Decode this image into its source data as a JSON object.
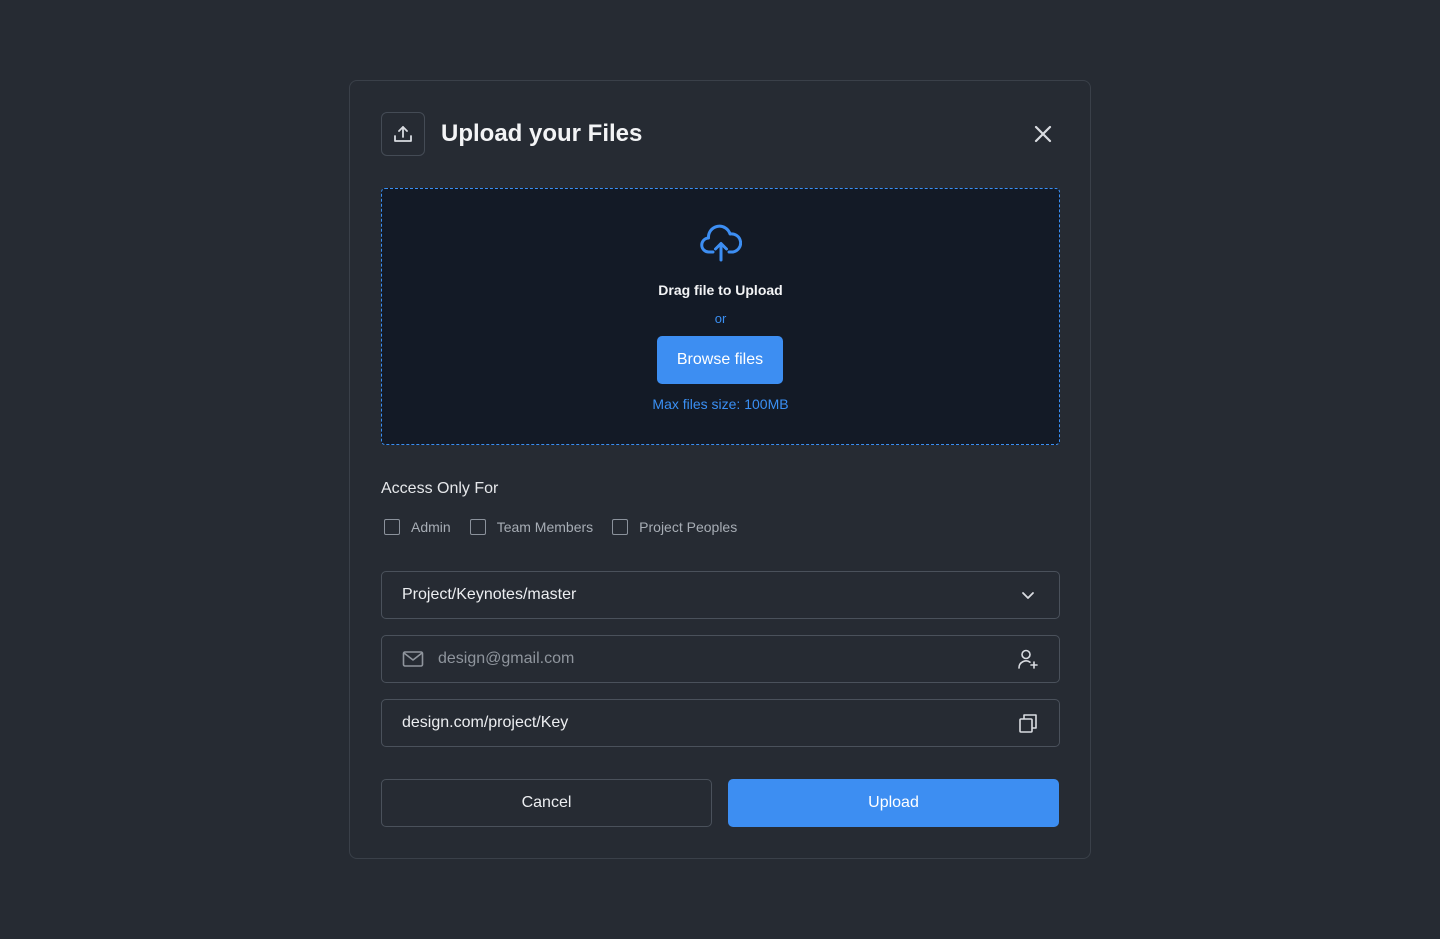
{
  "dialog": {
    "title": "Upload your Files",
    "header_icon": "upload-icon",
    "close_icon": "close-icon"
  },
  "dropzone": {
    "icon": "cloud-upload-icon",
    "drag_text": "Drag file to Upload",
    "or_text": "or",
    "browse_label": "Browse files",
    "max_size_text": "Max files size: 100MB"
  },
  "access": {
    "label": "Access Only For",
    "options": [
      {
        "label": "Admin",
        "checked": false
      },
      {
        "label": "Team Members",
        "checked": false
      },
      {
        "label": "Project Peoples",
        "checked": false
      }
    ]
  },
  "folder_select": {
    "value": "Project/Keynotes/master",
    "icon": "chevron-down-icon"
  },
  "email_field": {
    "placeholder": "design@gmail.com",
    "leading_icon": "mail-icon",
    "trailing_icon": "add-user-icon"
  },
  "link_field": {
    "value": "design.com/project/Key",
    "trailing_icon": "copy-icon"
  },
  "actions": {
    "cancel_label": "Cancel",
    "upload_label": "Upload"
  },
  "colors": {
    "accent": "#3d8ef2",
    "background": "#262b33",
    "dropzone_bg": "#131a26"
  }
}
